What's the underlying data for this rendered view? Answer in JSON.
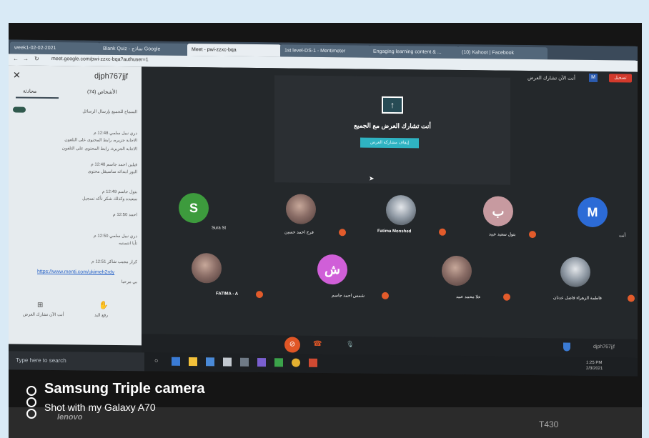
{
  "browser": {
    "tabs": [
      "week1-02-02-2021",
      "Blank Quiz - نماذج Google",
      "Meet - pwi-zzxc-bqa",
      "1st level-DS-1 - Mentimeter",
      "Engaging learning content & ...",
      "(10) Kahoot | Facebook"
    ],
    "url": "meet.google.com/pwi-zzxc-bqa?authuser=1"
  },
  "sidebar": {
    "meeting_code": "djph767jjf",
    "people_label": "(74) الأشخاص",
    "chat_label": "محادثة",
    "allow_label": "السماح للجميع بإرسال الرسائل",
    "messages": [
      "دري نبيل سلمي 12:48 م",
      "الاجابة جزيره، رابط المحتوى على التلفون",
      "الاجابة الجزيرة، رابط المحتوى على التلفون",
      "فيلين احمد جاسم 12:48 م",
      "النور ابتدائه ساسيقل محتوى",
      "بتول جاسم 12:49 م",
      "سعيده وكذلك شكر تأكد تسجيل",
      "احمد 12:50 م",
      "دري نبيل سلمي 12:50 م",
      "تأيا انتستيه",
      "كرار مجيب شاكر 12:51 م",
      "بي مرحبا"
    ],
    "link": "https://www.menti.com/ukimeh2rdy",
    "footer_left": "أنت الآن تشارك العرض",
    "footer_right": "رفع اليد"
  },
  "meeting": {
    "presenting_top_label": "أنت الآن تشارك العرض",
    "m_badge": "M",
    "record_label": "تسجيل",
    "present_text": "أنت تشارك العرض مع الجميع",
    "stop_button": "إيقاف مشاركة العرض",
    "participants": [
      {
        "initial": "S",
        "name": "Sura St",
        "color": "#3d9b3d"
      },
      {
        "initial": "",
        "name": "فرح احمد حسين",
        "color": "#8b6e67"
      },
      {
        "initial": "",
        "name": "Fatima Monshed",
        "color": "#3c434a"
      },
      {
        "initial": "ب",
        "name": "بتول سعيد عبيد",
        "color": "#c79aa0"
      },
      {
        "initial": "M",
        "name": "أنت",
        "color": "#2c6bd6"
      },
      {
        "initial": "",
        "name": "FATIMA - A",
        "color": "#8b6e67"
      },
      {
        "initial": "ش",
        "name": "شمس احمد جاسم",
        "color": "#d05fd8"
      },
      {
        "initial": "",
        "name": "علا محمد عبيد",
        "color": "#8b6e67"
      },
      {
        "initial": "",
        "name": "فاطمة الزهراء فاضل عدنان",
        "color": "#3c434a"
      }
    ],
    "code_right": "djph767jjf"
  },
  "taskbar": {
    "search_placeholder": "Type here to search",
    "time": "1:25 PM",
    "date": "2/3/2021"
  },
  "photo": {
    "watermark_title": "Samsung Triple camera",
    "watermark_sub": "Shot with my Galaxy A70",
    "brand": "lenovo",
    "model": "T430"
  }
}
